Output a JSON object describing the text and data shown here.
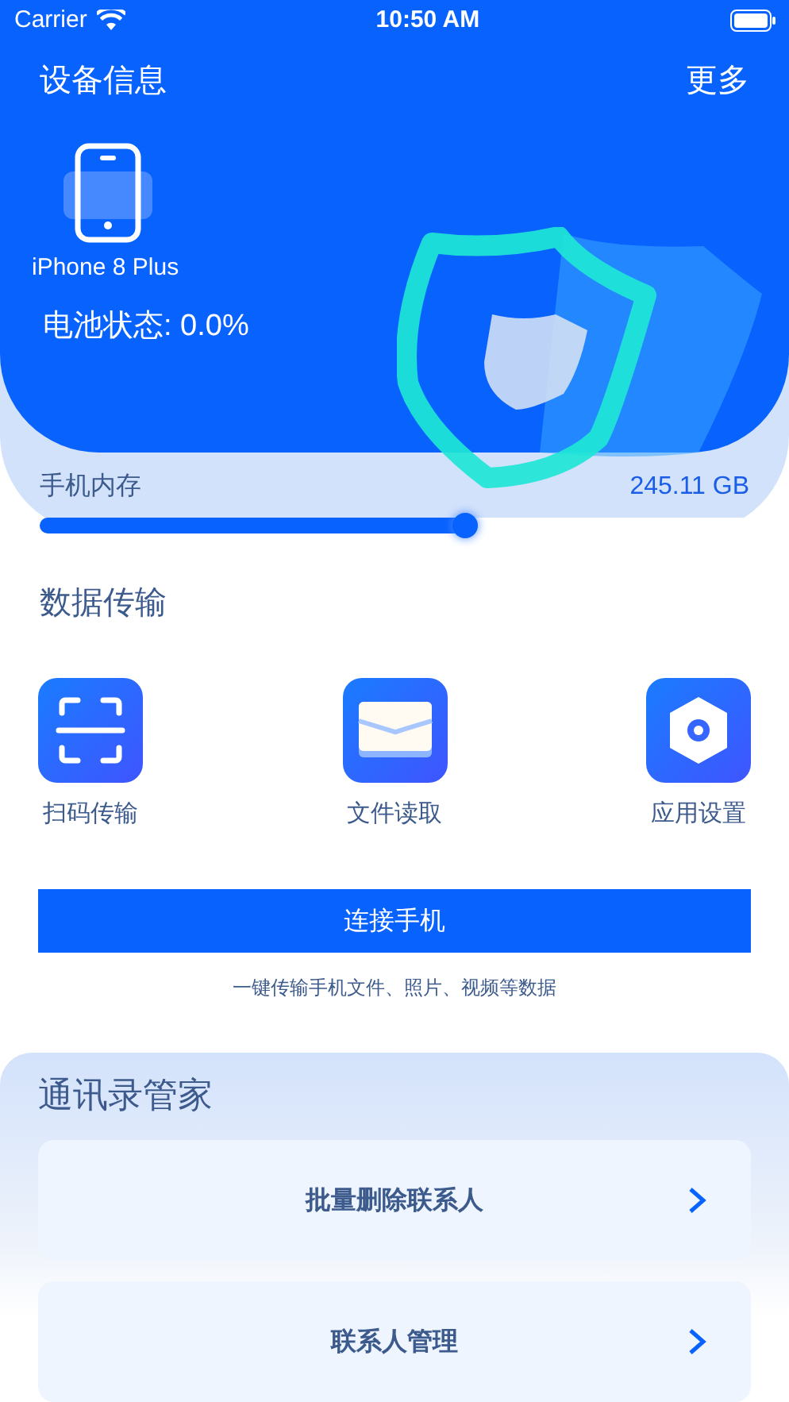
{
  "status_bar": {
    "carrier": "Carrier",
    "time": "10:50 AM"
  },
  "header": {
    "title": "设备信息",
    "more": "更多"
  },
  "device": {
    "name": "iPhone 8 Plus",
    "battery": "电池状态: 0.0%"
  },
  "storage": {
    "label": "手机内存",
    "value": "245.11 GB",
    "level": 0.6
  },
  "transfer": {
    "title": "数据传输",
    "actions": [
      {
        "kind": "scan",
        "label": "扫码传输"
      },
      {
        "kind": "file",
        "label": "文件读取"
      },
      {
        "kind": "settings",
        "label": "应用设置"
      }
    ],
    "button": "连接手机",
    "caption": "一键传输手机文件、照片、视频等数据"
  },
  "contacts": {
    "title": "通讯录管家",
    "items": [
      {
        "label": "批量删除联系人"
      },
      {
        "label": "联系人管理"
      }
    ]
  }
}
